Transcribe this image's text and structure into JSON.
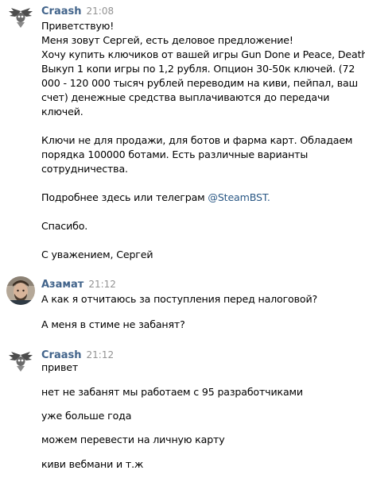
{
  "messages": [
    {
      "author": "Craash",
      "time": "21:08",
      "avatar": "wings-skull-logo",
      "lines": [
        "Приветствую!",
        "Меня зовут Сергей, есть деловое предложение!",
        "Хочу купить ключиков от вашей игры Gun Done и Peace, Death!",
        "Выкуп 1 копи игры по 1,2 рубля. Опцион 30-50к ключей. (72",
        "000 - 120 000 тысяч рублей переводим на киви, пейпал, ваш",
        "счет) денежные средства выплачиваются до передачи",
        "ключей.",
        "Ключи не для продажи, для ботов и фарма карт. Обладаем",
        "порядка 100000 ботами. Есть различные варианты",
        "сотрудничества.",
        "Подробнее здесь или телеграм",
        "Спасибо.",
        "С уважением, Сергей"
      ],
      "link": "@SteamBST."
    },
    {
      "author": "Азамат",
      "time": "21:12",
      "avatar": "user-photo",
      "lines": [
        "А как я отчитаюсь за поступления перед налоговой?",
        "А меня в стиме не забанят?"
      ]
    },
    {
      "author": "Craash",
      "time": "21:12",
      "avatar": "wings-skull-logo",
      "lines": [
        "привет",
        "нет не забанят мы работаем с 95 разработчиками",
        "уже больше года",
        "можем перевести на личную карту",
        "киви вебмани и т.ж"
      ]
    }
  ],
  "colors": {
    "author": "#42648b",
    "time": "#939393",
    "link": "#2a5885",
    "text": "#000000"
  }
}
